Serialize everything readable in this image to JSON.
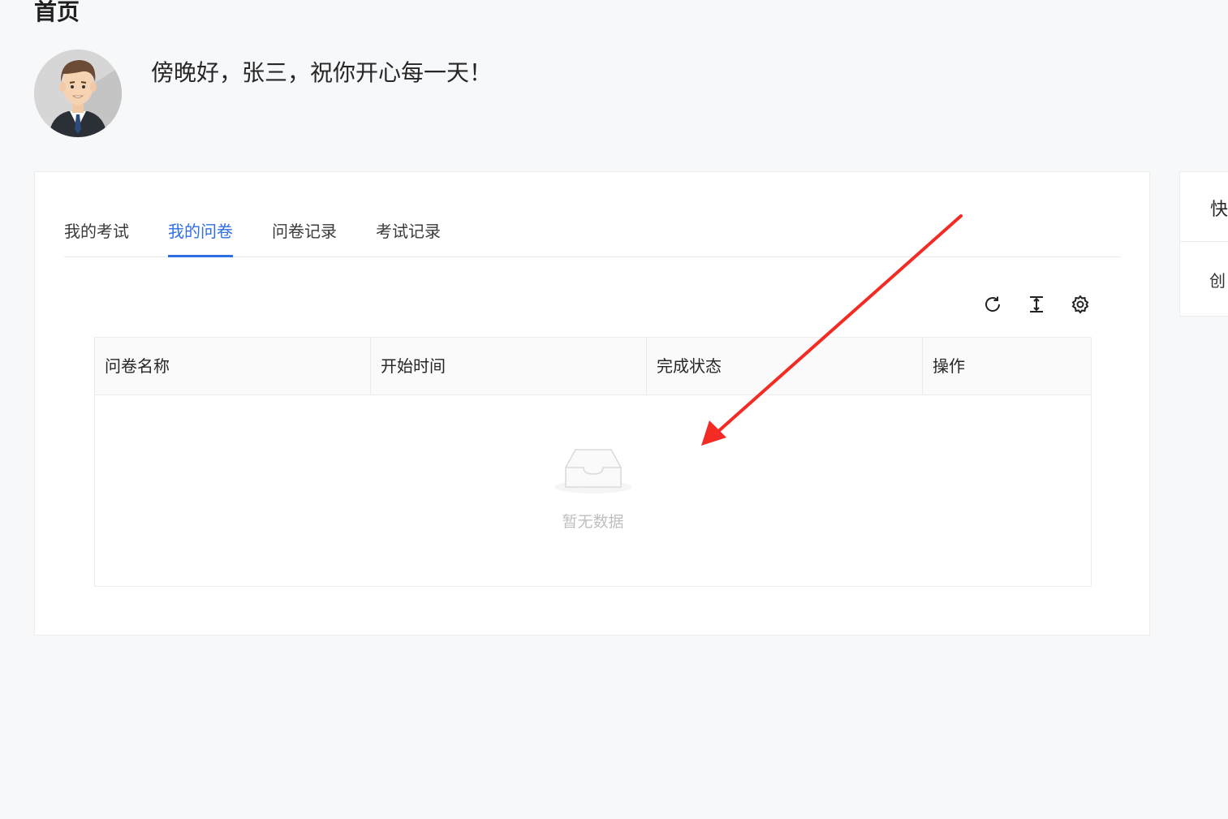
{
  "header": {
    "title": "首页",
    "greeting": "傍晚好，张三，祝你开心每一天！"
  },
  "tabs": [
    {
      "label": "我的考试",
      "active": false
    },
    {
      "label": "我的问卷",
      "active": true
    },
    {
      "label": "问卷记录",
      "active": false
    },
    {
      "label": "考试记录",
      "active": false
    }
  ],
  "toolbar": {
    "icons": [
      "refresh-icon",
      "column-height-icon",
      "settings-icon"
    ]
  },
  "table": {
    "columns": [
      "问卷名称",
      "开始时间",
      "完成状态",
      "操作"
    ],
    "empty_text": "暂无数据"
  },
  "side_panel": {
    "title": "快",
    "item": "创"
  },
  "colors": {
    "accent": "#2f6fe6",
    "arrow": "#f42a24",
    "background": "#f7f8fa"
  }
}
